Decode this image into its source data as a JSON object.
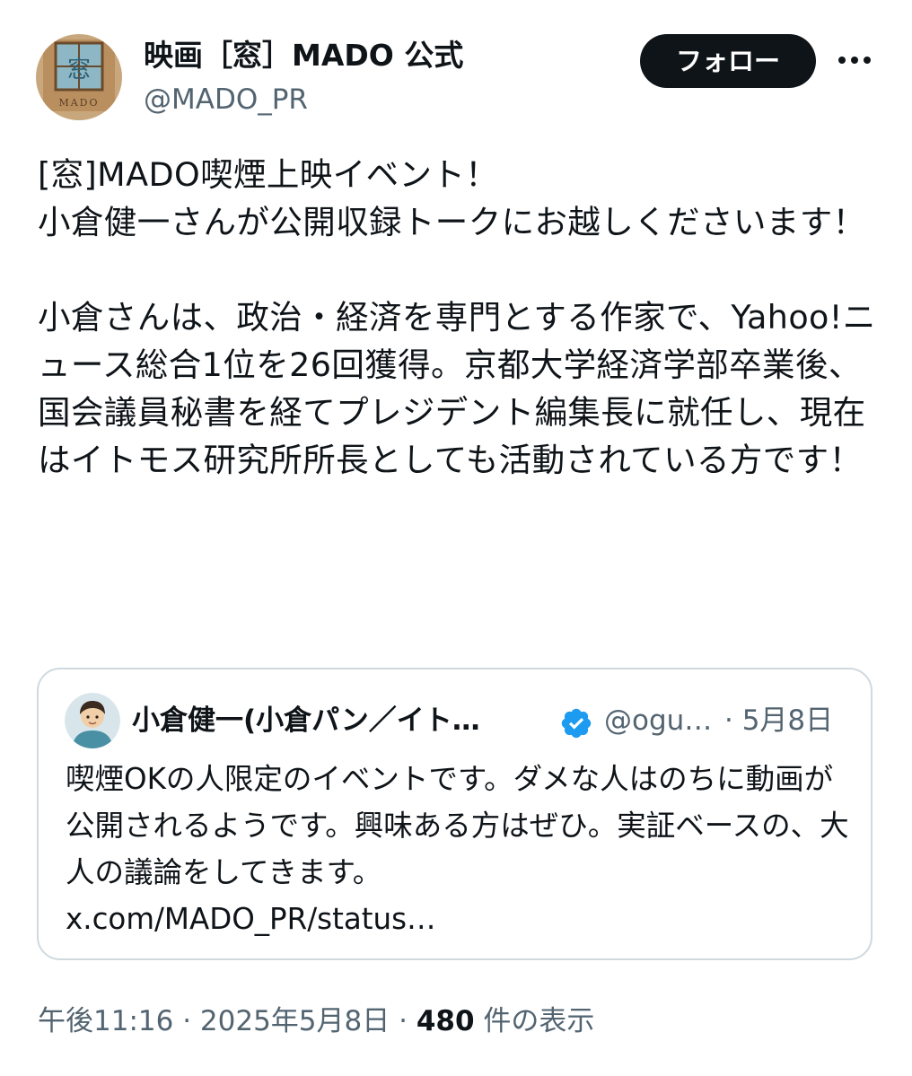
{
  "author": {
    "display_name": "映画［窓］MADO 公式",
    "handle": "@MADO_PR",
    "avatar_caption": "MADO"
  },
  "actions": {
    "follow_label": "フォロー",
    "more_icon": "more-horizontal-icon"
  },
  "tweet": {
    "text": "[窓]MADO喫煙上映イベント！\n小倉健一さんが公開収録トークにお越しくださいます！\n\n小倉さんは、政治・経済を専門とする作家で、Yahoo!ニュース総合1位を26回獲得。京都大学経済学部卒業後、国会議員秘書を経てプレジデント編集長に就任し、現在はイトモス研究所所長としても活動されている方です！"
  },
  "quote": {
    "display_name": "小倉健一(小倉パン／イト…",
    "verified_icon": "verified-badge-icon",
    "handle": "@ogu…",
    "date": "· 5月8日",
    "text": "喫煙OKの人限定のイベントです。ダメな人はのちに動画が公開されるようです。興味ある方はぜひ。実証ベースの、大人の議論をしてきます。",
    "link": "x.com/MADO_PR/status…"
  },
  "meta": {
    "time": "午後11:16",
    "sep1": " · ",
    "date": "2025年5月8日",
    "sep2": " · ",
    "views_count": "480",
    "views_label": " 件の表示"
  },
  "colors": {
    "text_primary": "#0f1419",
    "text_secondary": "#536471",
    "border": "#cfd9de",
    "verified": "#1d9bf0",
    "follow_bg": "#0f1419"
  }
}
